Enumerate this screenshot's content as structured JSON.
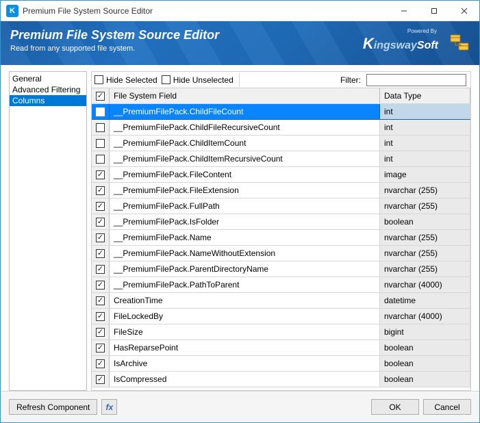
{
  "window": {
    "title": "Premium File System Source Editor",
    "app_icon_letter": "K"
  },
  "header": {
    "title": "Premium File System Source Editor",
    "subtitle": "Read from any supported file system.",
    "powered_by": "Powered By",
    "logo_k": "K",
    "logo_mid": "ingsway",
    "logo_end": "Soft"
  },
  "sidebar": {
    "items": [
      {
        "label": "General",
        "selected": false
      },
      {
        "label": "Advanced Filtering",
        "selected": false
      },
      {
        "label": "Columns",
        "selected": true
      }
    ]
  },
  "filter_row": {
    "hide_selected": "Hide Selected",
    "hide_unselected": "Hide Unselected",
    "filter_label": "Filter:",
    "filter_value": ""
  },
  "grid": {
    "header_check": true,
    "col_field": "File System Field",
    "col_type": "Data Type",
    "rows": [
      {
        "checked": false,
        "selected": true,
        "field": "__PremiumFilePack.ChildFileCount",
        "type": "int"
      },
      {
        "checked": false,
        "selected": false,
        "field": "__PremiumFilePack.ChildFileRecursiveCount",
        "type": "int"
      },
      {
        "checked": false,
        "selected": false,
        "field": "__PremiumFilePack.ChildItemCount",
        "type": "int"
      },
      {
        "checked": false,
        "selected": false,
        "field": "__PremiumFilePack.ChildItemRecursiveCount",
        "type": "int"
      },
      {
        "checked": true,
        "selected": false,
        "field": "__PremiumFilePack.FileContent",
        "type": "image"
      },
      {
        "checked": true,
        "selected": false,
        "field": "__PremiumFilePack.FileExtension",
        "type": "nvarchar (255)"
      },
      {
        "checked": true,
        "selected": false,
        "field": "__PremiumFilePack.FullPath",
        "type": "nvarchar (255)"
      },
      {
        "checked": true,
        "selected": false,
        "field": "__PremiumFilePack.IsFolder",
        "type": "boolean"
      },
      {
        "checked": true,
        "selected": false,
        "field": "__PremiumFilePack.Name",
        "type": "nvarchar (255)"
      },
      {
        "checked": true,
        "selected": false,
        "field": "__PremiumFilePack.NameWithoutExtension",
        "type": "nvarchar (255)"
      },
      {
        "checked": true,
        "selected": false,
        "field": "__PremiumFilePack.ParentDirectoryName",
        "type": "nvarchar (255)"
      },
      {
        "checked": true,
        "selected": false,
        "field": "__PremiumFilePack.PathToParent",
        "type": "nvarchar (4000)"
      },
      {
        "checked": true,
        "selected": false,
        "field": "CreationTime",
        "type": "datetime"
      },
      {
        "checked": true,
        "selected": false,
        "field": "FileLockedBy",
        "type": "nvarchar (4000)"
      },
      {
        "checked": true,
        "selected": false,
        "field": "FileSize",
        "type": "bigint"
      },
      {
        "checked": true,
        "selected": false,
        "field": "HasReparsePoint",
        "type": "boolean"
      },
      {
        "checked": true,
        "selected": false,
        "field": "IsArchive",
        "type": "boolean"
      },
      {
        "checked": true,
        "selected": false,
        "field": "IsCompressed",
        "type": "boolean"
      }
    ]
  },
  "footer": {
    "refresh": "Refresh Component",
    "fx": "fx",
    "ok": "OK",
    "cancel": "Cancel"
  }
}
